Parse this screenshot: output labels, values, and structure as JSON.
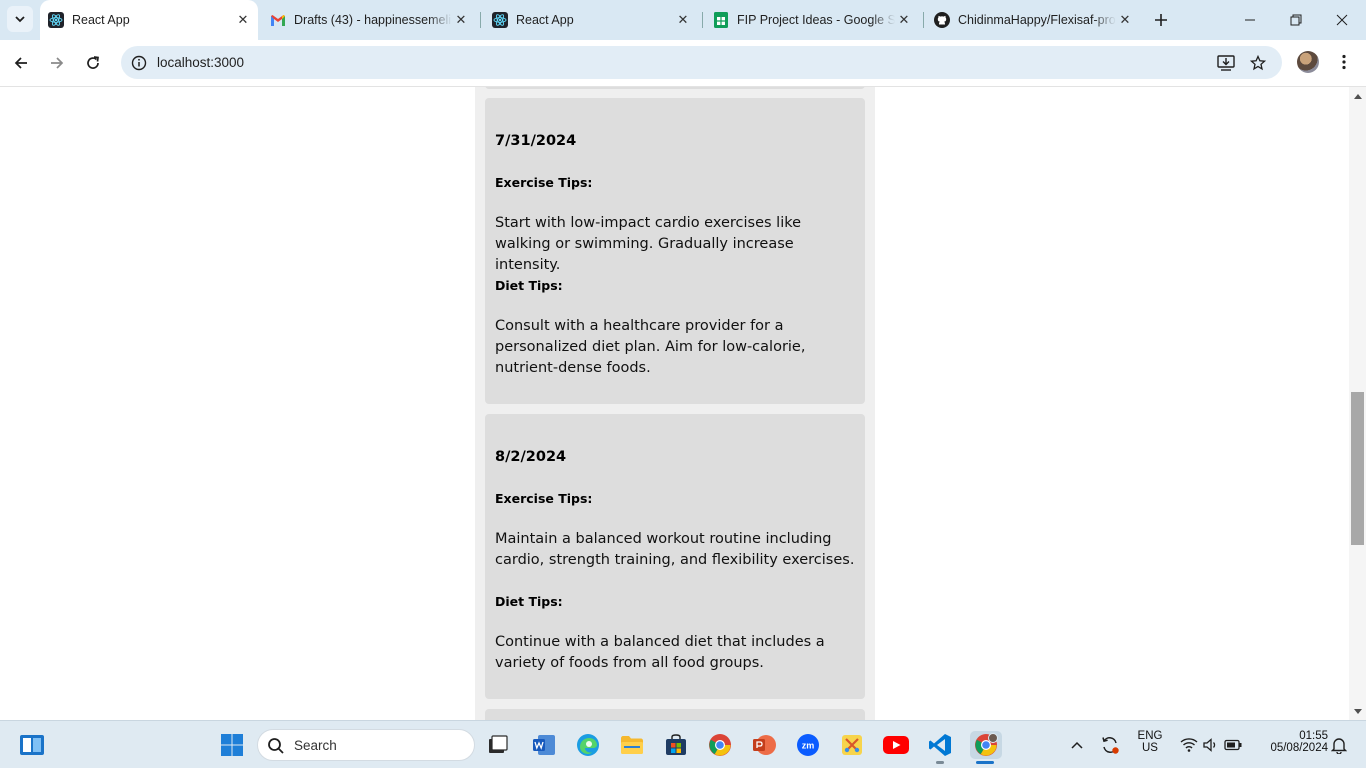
{
  "browser": {
    "tabs": [
      {
        "title": "React App",
        "icon": "react-icon",
        "active": true
      },
      {
        "title": "Drafts (43) - happinessemeli",
        "icon": "gmail-icon",
        "active": false
      },
      {
        "title": "React App",
        "icon": "react-icon",
        "active": false
      },
      {
        "title": "FIP Project Ideas - Google Sh",
        "icon": "google-sheets-icon",
        "active": false
      },
      {
        "title": "ChidinmaHappy/Flexisaf-pro",
        "icon": "github-icon",
        "active": false
      }
    ],
    "url": "localhost:3000"
  },
  "page": {
    "cards": [
      {
        "date": "7/31/2024",
        "exercise_label": "Exercise Tips:",
        "exercise_text": "Start with low-impact cardio exercises like walking or swimming. Gradually increase intensity.",
        "diet_label": "Diet Tips:",
        "diet_text": "Consult with a healthcare provider for a personalized diet plan. Aim for low-calorie, nutrient-dense foods."
      },
      {
        "date": "8/2/2024",
        "exercise_label": "Exercise Tips:",
        "exercise_text": "Maintain a balanced workout routine including cardio, strength training, and flexibility exercises.",
        "diet_label": "Diet Tips:",
        "diet_text": "Continue with a balanced diet that includes a variety of foods from all food groups."
      }
    ]
  },
  "taskbar": {
    "search_placeholder": "Search",
    "language_line1": "ENG",
    "language_line2": "US",
    "time": "01:55",
    "date": "05/08/2024"
  },
  "colors": {
    "card_bg": "#dddddd",
    "column_bg": "#efefef",
    "tabstrip_bg": "#d9e8f3"
  }
}
